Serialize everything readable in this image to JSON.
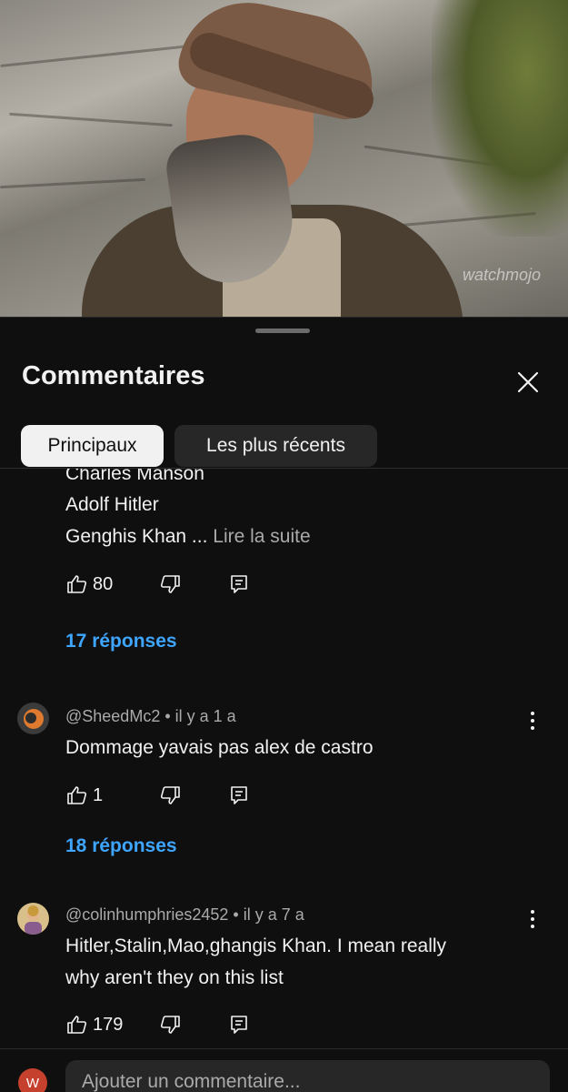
{
  "video": {
    "watermark": "watchmojo"
  },
  "sheet": {
    "title": "Commentaires",
    "chips": {
      "top": "Principaux",
      "newest": "Les plus récents"
    }
  },
  "comments": [
    {
      "lines": [
        "Charles Manson",
        "Adolf Hitler",
        "Genghis Khan ..."
      ],
      "read_more": "Lire la suite",
      "likes": "80",
      "replies": "17 réponses"
    },
    {
      "author": "@SheedMc2",
      "time": "il y a 1 a",
      "lines": [
        "Dommage yavais pas alex de castro"
      ],
      "likes": "1",
      "replies": "18 réponses"
    },
    {
      "author": "@colinhumphries2452",
      "time": "il y a 7 a",
      "lines": [
        "Hitler,Stalin,Mao,ghangis Khan. I mean really",
        "why aren't they on this list"
      ],
      "likes": "179"
    }
  ],
  "composer": {
    "avatar_initial": "W",
    "placeholder": "Ajouter un commentaire..."
  },
  "colors": {
    "background": "#0f0f0f",
    "chip_active": "#f1f1f1",
    "chip_inactive": "#272727",
    "link": "#3ea6ff",
    "secondary_text": "#aaaaaa",
    "user_avatar": "#c5412e"
  },
  "icons": [
    "close-icon",
    "thumbs-up-icon",
    "thumbs-down-icon",
    "reply-icon",
    "more-vert-icon"
  ]
}
